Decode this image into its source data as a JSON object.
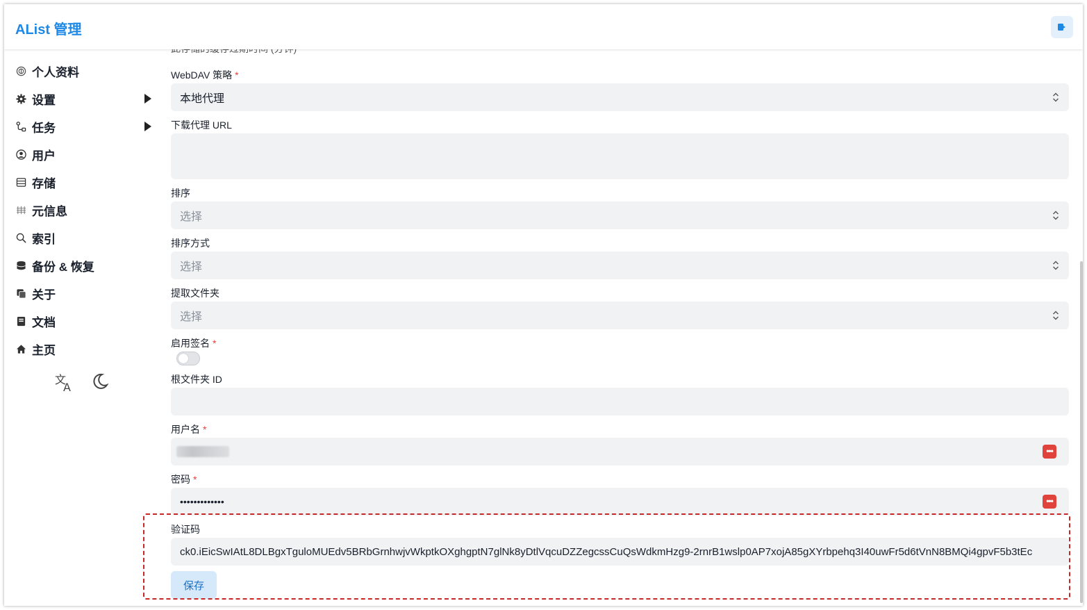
{
  "header": {
    "title": "AList 管理",
    "logout_icon": "logout-icon"
  },
  "sidebar": {
    "items": [
      {
        "label": "个人资料",
        "icon": "fingerprint-icon"
      },
      {
        "label": "设置",
        "icon": "gear-icon"
      },
      {
        "label": "任务",
        "icon": "flow-icon"
      },
      {
        "label": "用户",
        "icon": "user-circle-icon"
      },
      {
        "label": "存储",
        "icon": "database-icon"
      },
      {
        "label": "元信息",
        "icon": "metadata-icon"
      },
      {
        "label": "索引",
        "icon": "search-icon"
      },
      {
        "label": "备份 & 恢复",
        "icon": "stack-icon"
      },
      {
        "label": "关于",
        "icon": "copy-icon"
      },
      {
        "label": "文档",
        "icon": "book-icon"
      },
      {
        "label": "主页",
        "icon": "home-icon"
      }
    ],
    "tools": {
      "language_icon": "translate-icon",
      "theme_icon": "moon-icon"
    }
  },
  "form": {
    "cut_off_hint": "此存储的缓存过期时间 (分钟)",
    "webdav_policy": {
      "label": "WebDAV 策略",
      "required": "*",
      "value": "本地代理"
    },
    "download_proxy_url": {
      "label": "下载代理 URL",
      "value": ""
    },
    "order_by": {
      "label": "排序",
      "placeholder": "选择"
    },
    "order_direction": {
      "label": "排序方式",
      "placeholder": "选择"
    },
    "extract_folder": {
      "label": "提取文件夹",
      "placeholder": "选择"
    },
    "enable_sign": {
      "label": "启用签名",
      "required": "*",
      "enabled": false
    },
    "root_folder_id": {
      "label": "根文件夹 ID",
      "value": ""
    },
    "username": {
      "label": "用户名",
      "required": "*"
    },
    "password": {
      "label": "密码",
      "required": "*",
      "value": "•••••••••••••"
    },
    "captcha": {
      "label": "验证码",
      "value": "ck0.iEicSwIAtL8DLBgxTguloMUEdv5BRbGrnhwjvWkptkOXghgptN7glNk8yDtlVqcuDZZegcssCuQsWdkmHzg9-2rnrB1wslp0AP7xojA85gXYrbpehq3I40uwFr5d6tVnN8BMQi4gpvF5b3tEc"
    },
    "save_label": "保存"
  },
  "colors": {
    "accent": "#1e88e5",
    "required": "#e53e3e",
    "highlight": "#c62828"
  }
}
